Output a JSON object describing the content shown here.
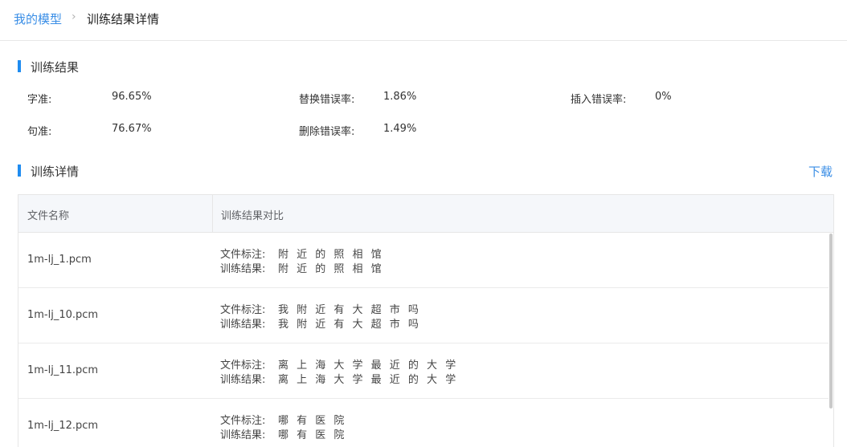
{
  "breadcrumb": {
    "parent": "我的模型",
    "separator": "›",
    "current": "训练结果详情"
  },
  "results": {
    "title": "训练结果",
    "stats": [
      {
        "label": "字准:",
        "value": "96.65%"
      },
      {
        "label": "替换错误率:",
        "value": "1.86%"
      },
      {
        "label": "插入错误率:",
        "value": "0%"
      },
      {
        "label": "句准:",
        "value": "76.67%"
      },
      {
        "label": "删除错误率:",
        "value": "1.49%"
      }
    ]
  },
  "details": {
    "title": "训练详情",
    "download_label": "下载",
    "columns": [
      "文件名称",
      "训练结果对比"
    ],
    "annotation_label": "文件标注:",
    "result_label": "训练结果:",
    "rows": [
      {
        "file": "1m-lj_1.pcm",
        "annotation": "附 近 的 照 相 馆",
        "result": "附 近 的 照 相 馆"
      },
      {
        "file": "1m-lj_10.pcm",
        "annotation": "我 附 近 有 大 超 市 吗",
        "result": "我 附 近 有 大 超 市 吗"
      },
      {
        "file": "1m-lj_11.pcm",
        "annotation": "离 上 海 大 学 最 近 的 大 学",
        "result": "离 上 海 大 学 最 近 的 大 学"
      },
      {
        "file": "1m-lj_12.pcm",
        "annotation": "哪 有 医 院",
        "result": "哪 有 医 院"
      }
    ]
  },
  "colors": {
    "accent": "#1f8cf0",
    "link": "#3a8ee6",
    "header_bg": "#f5f7fa"
  }
}
